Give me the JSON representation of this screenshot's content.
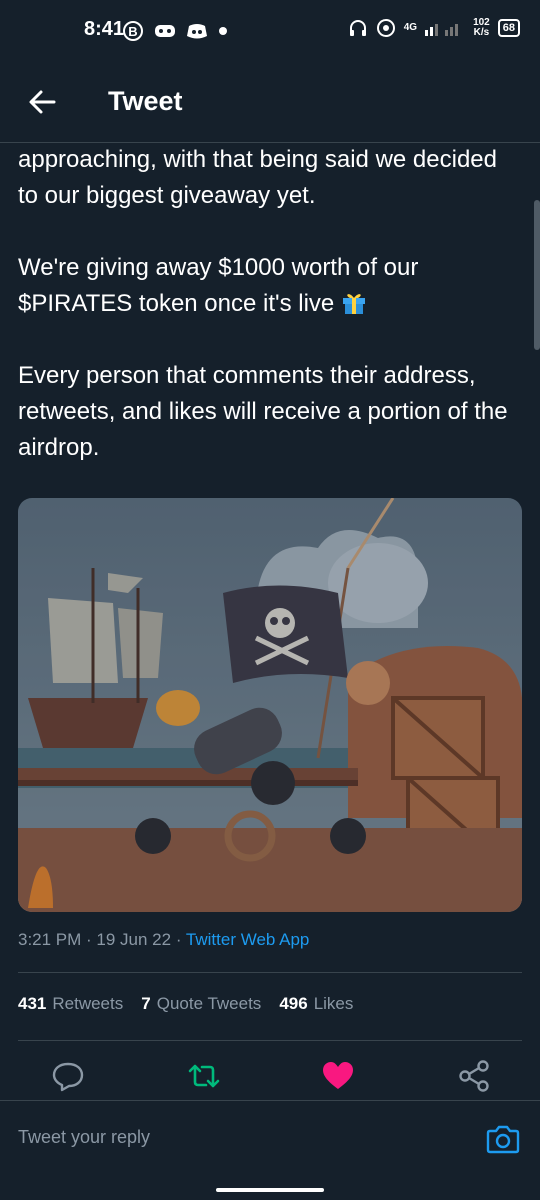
{
  "status_bar": {
    "time": "8:41",
    "network_type": "4G",
    "speed_value": "102",
    "speed_unit": "K/s",
    "battery": "68"
  },
  "header": {
    "title": "Tweet"
  },
  "tweet": {
    "paragraphs": [
      "approaching, with that being said we decided to our biggest giveaway yet.",
      "We're giving away $1000 worth of our $PIRATES token once it's live",
      "Every person that comments their address, retweets, and likes will receive a portion of the airdrop."
    ],
    "time": "3:21 PM",
    "date": "19 Jun 22",
    "source": "Twitter Web App"
  },
  "stats": {
    "retweets_count": "431",
    "retweets_label": "Retweets",
    "quotes_count": "7",
    "quotes_label": "Quote Tweets",
    "likes_count": "496",
    "likes_label": "Likes"
  },
  "reply": {
    "placeholder": "Tweet your reply"
  },
  "colors": {
    "background": "#15202b",
    "accent": "#1d9bf0",
    "retweet": "#00ba7c",
    "like": "#f91880",
    "muted": "#8b98a5"
  }
}
